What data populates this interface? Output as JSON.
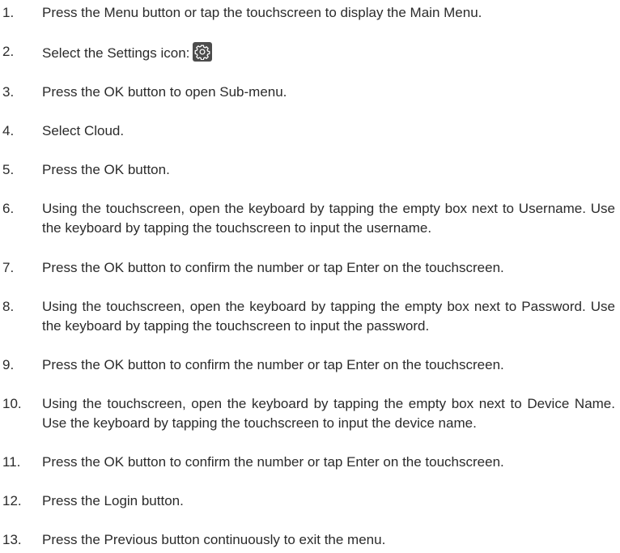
{
  "steps": [
    {
      "num": "1.",
      "text": "Press the Menu button or tap the touchscreen to display the Main Menu."
    },
    {
      "num": "2.",
      "text": "Select the Settings icon:",
      "icon": "settings-gear-icon"
    },
    {
      "num": "3.",
      "text": "Press the OK button to open Sub-menu."
    },
    {
      "num": "4.",
      "text": "Select Cloud."
    },
    {
      "num": "5.",
      "text": "Press the OK button."
    },
    {
      "num": "6.",
      "text": "Using the touchscreen, open the keyboard by tapping the empty box next to Username. Use the keyboard by tapping the touchscreen to input the username."
    },
    {
      "num": "7.",
      "text": "Press the OK button to confirm the number or tap Enter on the touchscreen."
    },
    {
      "num": "8.",
      "text": "Using the touchscreen, open the keyboard by tapping the empty box next to Password. Use the keyboard by tapping the touchscreen to input the password."
    },
    {
      "num": "9.",
      "text": "Press the OK button to confirm the number or tap Enter on the touchscreen."
    },
    {
      "num": "10.",
      "text": "Using the touchscreen, open the keyboard by tapping the empty box next to Device Name. Use the keyboard by tapping the touchscreen to input the device name."
    },
    {
      "num": "11.",
      "text": "Press the OK button to confirm the number or tap Enter on the touchscreen."
    },
    {
      "num": "12.",
      "text": "Press the Login button."
    },
    {
      "num": "13.",
      "text": "Press the Previous button continuously to exit the menu."
    }
  ],
  "colors": {
    "text": "#2b2b2b",
    "icon_background": "#4c4c4c",
    "icon_foreground": "#ffffff"
  }
}
